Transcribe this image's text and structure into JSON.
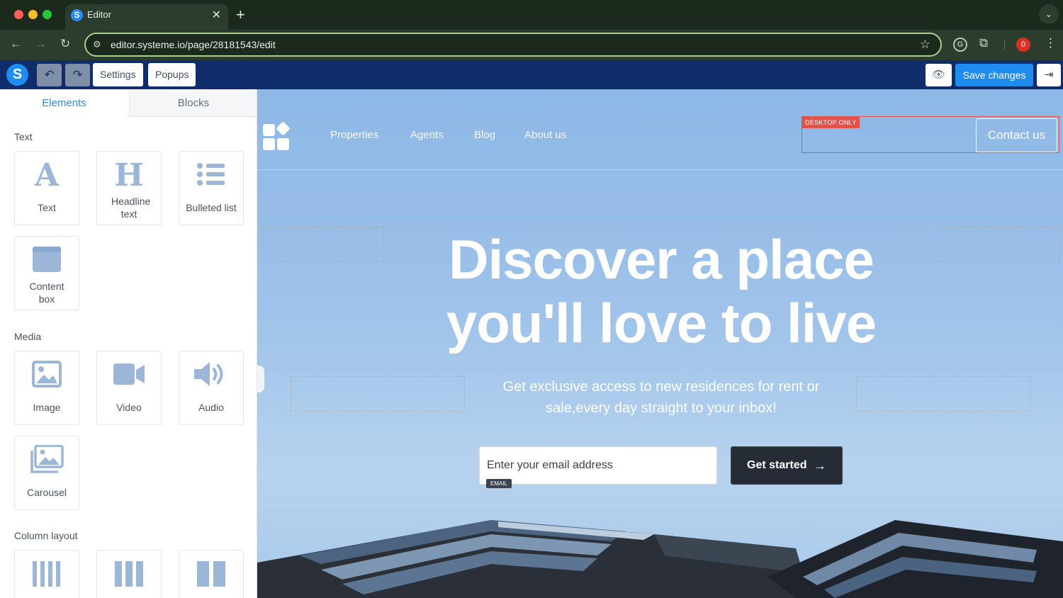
{
  "browser": {
    "tab_title": "Editor",
    "tab_favicon": "S",
    "url": "editor.systeme.io/page/28181543/edit",
    "extension_badge": "0",
    "extension_g": "G"
  },
  "editor": {
    "logo": "S",
    "settings_label": "Settings",
    "popups_label": "Popups",
    "save_label": "Save changes"
  },
  "panel": {
    "tabs": [
      {
        "label": "Elements"
      },
      {
        "label": "Blocks"
      }
    ],
    "sections": {
      "text": "Text",
      "media": "Media",
      "columns": "Column layout"
    },
    "text_items": [
      {
        "label": "Text",
        "icon": "text-icon"
      },
      {
        "label": "Headline text",
        "icon": "headline-icon"
      },
      {
        "label": "Bulleted list",
        "icon": "bulleted-list-icon"
      },
      {
        "label": "Content box",
        "icon": "content-box-icon"
      }
    ],
    "media_items": [
      {
        "label": "Image",
        "icon": "image-icon"
      },
      {
        "label": "Video",
        "icon": "video-icon"
      },
      {
        "label": "Audio",
        "icon": "audio-icon"
      },
      {
        "label": "Carousel",
        "icon": "carousel-icon"
      }
    ],
    "column_items": [
      {
        "icon": "four-column-icon"
      },
      {
        "icon": "three-column-icon"
      },
      {
        "icon": "two-column-icon"
      }
    ]
  },
  "site": {
    "nav": [
      "Properties",
      "Agents",
      "Blog",
      "About us"
    ],
    "desktop_only_tag": "DESKTOP ONLY",
    "contact_label": "Contact us",
    "hero_line1": "Discover a place",
    "hero_line2": "you'll love to live",
    "hero_subtitle": "Get exclusive access to new residences for rent or sale,every day straight to your inbox!",
    "email_placeholder": "Enter your email address",
    "email_tag": "EMAIL",
    "cta_label": "Get started"
  },
  "colors": {
    "editor_bar": "#0f2d6b",
    "accent": "#1f8cf0",
    "cta": "#252c35",
    "desktop_only": "#e0524c"
  }
}
